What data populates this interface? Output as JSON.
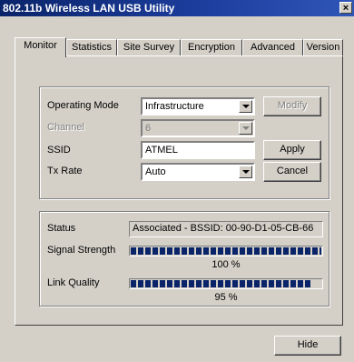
{
  "window": {
    "title": "802.11b Wireless LAN USB Utility"
  },
  "tabs": [
    "Monitor",
    "Statistics",
    "Site Survey",
    "Encryption",
    "Advanced",
    "Version"
  ],
  "settings": {
    "operating_mode_label": "Operating Mode",
    "operating_mode_value": "Infrastructure",
    "channel_label": "Channel",
    "channel_value": "6",
    "ssid_label": "SSID",
    "ssid_value": "ATMEL",
    "tx_rate_label": "Tx Rate",
    "tx_rate_value": "Auto"
  },
  "buttons": {
    "modify": "Modify",
    "apply": "Apply",
    "cancel": "Cancel",
    "hide": "Hide"
  },
  "status": {
    "status_label": "Status",
    "status_value": "Associated - BSSID: 00-90-D1-05-CB-66",
    "signal_label": "Signal Strength",
    "signal_percent_text": "100 %",
    "signal_level": 1.0,
    "link_label": "Link Quality",
    "link_percent_text": "95 %",
    "link_level": 0.95
  },
  "colors": {
    "titlebar": "#0a246a",
    "face": "#d4d0c8",
    "progress": "#0a246a"
  }
}
